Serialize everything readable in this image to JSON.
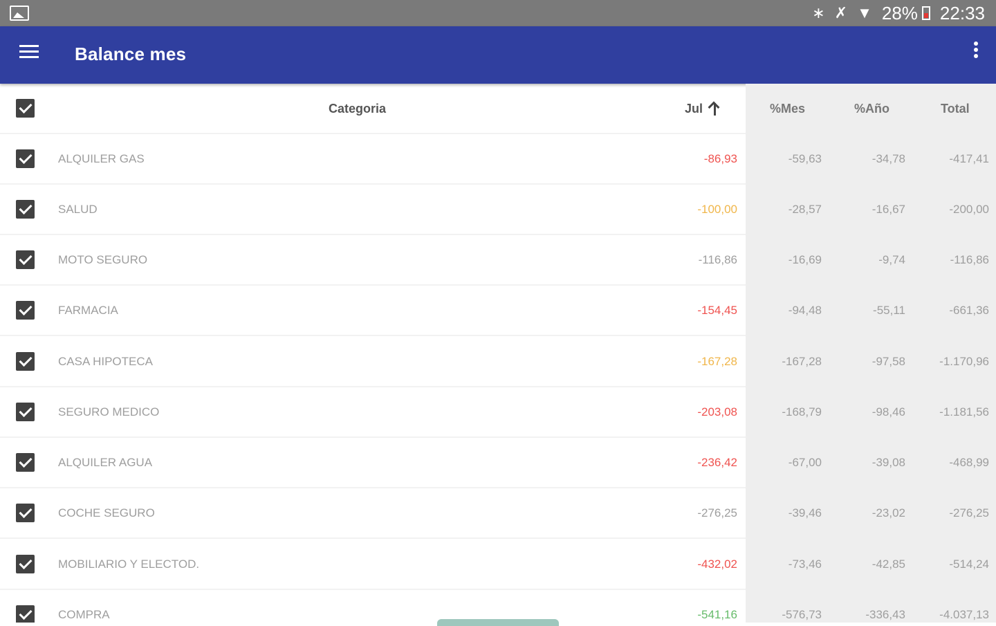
{
  "status_bar": {
    "gallery_icon": "gallery-icon",
    "bluetooth_icon": "bluetooth-icon",
    "mute_icon": "mute-icon",
    "wifi_icon": "wifi-icon",
    "battery": "28%",
    "time": "22:33"
  },
  "app_bar": {
    "title": "Balance mes",
    "menu_icon": "hamburger-menu-icon",
    "overflow_icon": "more-vert-icon"
  },
  "table": {
    "columns": {
      "categoria": "Categoria",
      "jul": "Jul",
      "mes": "%Mes",
      "ano": "%Año",
      "total": "Total"
    },
    "sort_icon": "arrow-up-icon",
    "colors": {
      "red": "#ef5350",
      "orange": "#f0b64a",
      "gray": "#9e9e9e",
      "green": "#66bb6a"
    },
    "rows": [
      {
        "category": "ALQUILER GAS",
        "jul": "-86,93",
        "jul_color": "#ef5350",
        "mes": "-59,63",
        "ano": "-34,78",
        "total": "-417,41"
      },
      {
        "category": "SALUD",
        "jul": "-100,00",
        "jul_color": "#f0b64a",
        "mes": "-28,57",
        "ano": "-16,67",
        "total": "-200,00"
      },
      {
        "category": "MOTO SEGURO",
        "jul": "-116,86",
        "jul_color": "#9e9e9e",
        "mes": "-16,69",
        "ano": "-9,74",
        "total": "-116,86"
      },
      {
        "category": "FARMACIA",
        "jul": "-154,45",
        "jul_color": "#ef5350",
        "mes": "-94,48",
        "ano": "-55,11",
        "total": "-661,36"
      },
      {
        "category": "CASA HIPOTECA",
        "jul": "-167,28",
        "jul_color": "#f0b64a",
        "mes": "-167,28",
        "ano": "-97,58",
        "total": "-1.170,96"
      },
      {
        "category": "SEGURO MEDICO",
        "jul": "-203,08",
        "jul_color": "#ef5350",
        "mes": "-168,79",
        "ano": "-98,46",
        "total": "-1.181,56"
      },
      {
        "category": "ALQUILER AGUA",
        "jul": "-236,42",
        "jul_color": "#ef5350",
        "mes": "-67,00",
        "ano": "-39,08",
        "total": "-468,99"
      },
      {
        "category": "COCHE SEGURO",
        "jul": "-276,25",
        "jul_color": "#9e9e9e",
        "mes": "-39,46",
        "ano": "-23,02",
        "total": "-276,25"
      },
      {
        "category": "MOBILIARIO Y ELECTOD.",
        "jul": "-432,02",
        "jul_color": "#ef5350",
        "mes": "-73,46",
        "ano": "-42,85",
        "total": "-514,24"
      },
      {
        "category": "COMPRA",
        "jul": "-541,16",
        "jul_color": "#66bb6a",
        "mes": "-576,73",
        "ano": "-336,43",
        "total": "-4.037,13"
      }
    ]
  }
}
